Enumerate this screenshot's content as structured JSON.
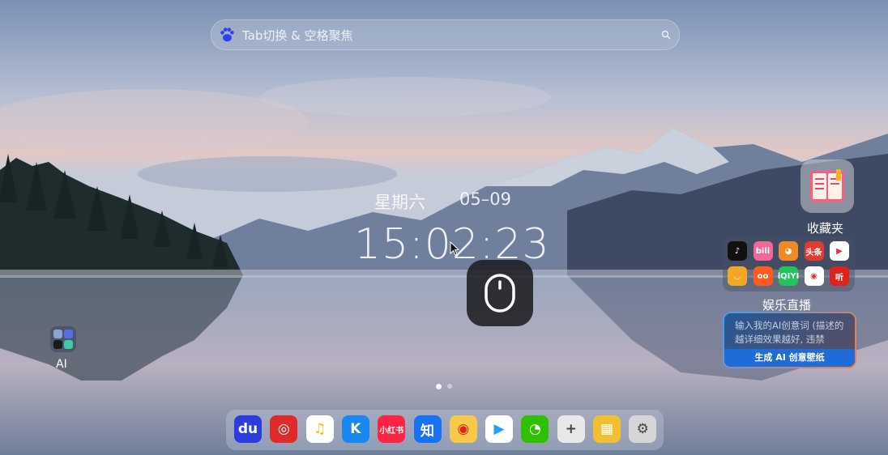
{
  "search": {
    "placeholder": "Tab切换 & 空格聚焦",
    "logo_icon": "baidu-paw-icon",
    "action_icon": "search-icon"
  },
  "clock": {
    "weekday": "星期六",
    "date": "05–09",
    "time": "15:02:23"
  },
  "floating_button": {
    "icon": "mouse-icon"
  },
  "ai_folder": {
    "label": "AI"
  },
  "favorites": {
    "label": "收藏夹",
    "icon": "book-icon"
  },
  "entertainment": {
    "label": "娱乐直播",
    "apps": [
      {
        "name": "douyin",
        "text": "♪",
        "color": "#111111"
      },
      {
        "name": "bilibili",
        "text": "bili",
        "color": "#f0679a"
      },
      {
        "name": "pet-app",
        "text": "◕",
        "color": "#f08a24"
      },
      {
        "name": "toutiao",
        "text": "头条",
        "color": "#e33a2f"
      },
      {
        "name": "video-player",
        "text": "▶",
        "color": "#ffffff"
      },
      {
        "name": "cat-app",
        "text": "◡",
        "color": "#f5a623"
      },
      {
        "name": "kuaishou",
        "text": "oo",
        "color": "#ff5a1f"
      },
      {
        "name": "iqiyi",
        "text": "iQIYI",
        "color": "#23c55a"
      },
      {
        "name": "weibo-live",
        "text": "◉",
        "color": "#ffffff"
      },
      {
        "name": "ting",
        "text": "听",
        "color": "#e0211c"
      }
    ]
  },
  "ai_wallpaper": {
    "hint": "输入我的AI创意词 (描述的越详细效果越好, 违禁",
    "button": "生成 AI 创意壁纸"
  },
  "dock": [
    {
      "name": "baidu",
      "text": "du",
      "color": "#2b3de0"
    },
    {
      "name": "netease-music",
      "text": "◎",
      "color": "#e02a2a"
    },
    {
      "name": "qq-music",
      "text": "♫",
      "color": "#ffffff"
    },
    {
      "name": "kugou",
      "text": "K",
      "color": "#1a86f0"
    },
    {
      "name": "xiaohongshu",
      "text": "小红书",
      "color": "#ff2442"
    },
    {
      "name": "zhihu",
      "text": "知",
      "color": "#1772f6"
    },
    {
      "name": "weibo",
      "text": "◉",
      "color": "#f7c948"
    },
    {
      "name": "tencent-video",
      "text": "▶",
      "color": "#ffffff"
    },
    {
      "name": "wechat",
      "text": "◔",
      "color": "#2dc100"
    },
    {
      "name": "add",
      "text": "+",
      "color": "#e8e8e8"
    },
    {
      "name": "wallpaper",
      "text": "▦",
      "color": "#f0c030"
    },
    {
      "name": "settings",
      "text": "⚙",
      "color": "#d6d6d6"
    }
  ]
}
